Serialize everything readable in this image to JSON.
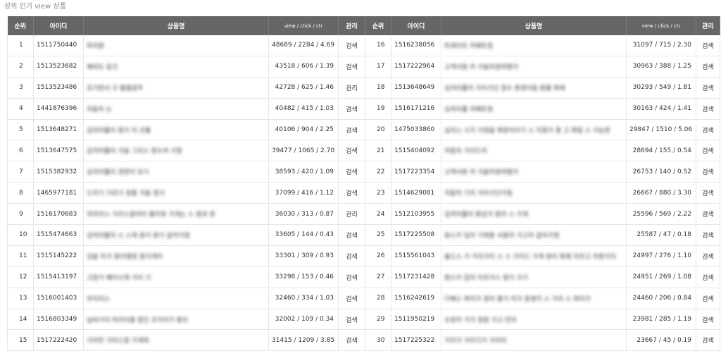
{
  "page_title": "상위 인기 view 상품",
  "columns": {
    "rank": "순위",
    "id": "아이디",
    "name": "상품명",
    "metric": "view / click / ctr",
    "action": "관리"
  },
  "rows": [
    {
      "l": {
        "rank": "1",
        "id": "1511750440",
        "name": "피자팜",
        "metric": "48689 / 2284 / 4.69",
        "action": "검색"
      },
      "r": {
        "rank": "16",
        "id": "1516238056",
        "name": "트레이트 카페트정",
        "metric": "31097 / 715 / 2.30",
        "action": "검색"
      }
    },
    {
      "l": {
        "rank": "2",
        "id": "1513523682",
        "name": "해야도 링크",
        "metric": "43518 / 606 / 1.39",
        "action": "검색"
      },
      "r": {
        "rank": "17",
        "id": "1517222964",
        "name": "고객서원 카 가을자정여행가",
        "metric": "30963 / 388 / 1.25",
        "action": "검색"
      }
    },
    {
      "l": {
        "rank": "3",
        "id": "1513523486",
        "name": "모기련서 크 팔콜광주",
        "metric": "42728 / 625 / 1.46",
        "action": "관리"
      },
      "r": {
        "rank": "18",
        "id": "1513648649",
        "name": "김치어플리 가리가인 정수 환경이동 환률 화제",
        "metric": "30293 / 549 / 1.81",
        "action": "검색"
      }
    },
    {
      "l": {
        "rank": "4",
        "id": "1441876396",
        "name": "자동차 는",
        "metric": "40482 / 415 / 1.03",
        "action": "검색"
      },
      "r": {
        "rank": "19",
        "id": "1516171216",
        "name": "김치어플 카페트정",
        "metric": "30163 / 424 / 1.41",
        "action": "검색"
      }
    },
    {
      "l": {
        "rank": "5",
        "id": "1513648271",
        "name": "김치어플리 원가 이 선물",
        "metric": "40106 / 904 / 2.25",
        "action": "검색"
      },
      "r": {
        "rank": "20",
        "id": "1475033860",
        "name": "심리스 시가 가정을 화랑이이기 스 지원가 중 고 화법 스 가능한",
        "metric": "29847 / 1510 / 5.06",
        "action": "검색"
      }
    },
    {
      "l": {
        "rank": "6",
        "id": "1513647575",
        "name": "김치어플리 가을 그리스 정수여 가정",
        "metric": "39477 / 1065 / 2.70",
        "action": "검색"
      },
      "r": {
        "rank": "21",
        "id": "1515404092",
        "name": "자동차 가이드리",
        "metric": "28694 / 155 / 0.54",
        "action": "검색"
      }
    },
    {
      "l": {
        "rank": "7",
        "id": "1515382932",
        "name": "김치어플리 관련이 모기",
        "metric": "38593 / 420 / 1.09",
        "action": "검색"
      },
      "r": {
        "rank": "22",
        "id": "1517223354",
        "name": "고객서원 카 가을자정여행가",
        "metric": "26753 / 140 / 0.52",
        "action": "검색"
      }
    },
    {
      "l": {
        "rank": "8",
        "id": "1465977181",
        "name": "드리기 가르기 정풍 가을 정가",
        "metric": "37099 / 416 / 1.12",
        "action": "검색"
      },
      "r": {
        "rank": "23",
        "id": "1514629081",
        "name": "자동차 기지 가리가인가정",
        "metric": "26667 / 880 / 3.30",
        "action": "검색"
      }
    },
    {
      "l": {
        "rank": "9",
        "id": "1516170683",
        "name": "자라리스 가리스갈야이 팔리유 가게는 스 원과 유",
        "metric": "36030 / 313 / 0.87",
        "action": "관리"
      },
      "r": {
        "rank": "24",
        "id": "1512103955",
        "name": "김치어플리 환상가 원리 스 가게",
        "metric": "25596 / 569 / 2.22",
        "action": "검색"
      }
    },
    {
      "l": {
        "rank": "10",
        "id": "1515474663",
        "name": "김치어플리 스 스캐 원가 원기 같아가정",
        "metric": "33605 / 144 / 0.43",
        "action": "검색"
      },
      "r": {
        "rank": "25",
        "id": "1517225508",
        "name": "원스키 입의 기레증 사용자 가고자 같아가정",
        "metric": "25587 / 47 / 0.18",
        "action": "검색"
      }
    },
    {
      "l": {
        "rank": "11",
        "id": "1515145222",
        "name": "김을 카가 원리행정 원가게리",
        "metric": "33301 / 309 / 0.93",
        "action": "검색"
      },
      "r": {
        "rank": "26",
        "id": "1515561043",
        "name": "올드스 가 가리가리 스 스 가이드 가게 원리 화제 자르고 차량가지",
        "metric": "24997 / 276 / 1.10",
        "action": "검색"
      }
    },
    {
      "l": {
        "rank": "12",
        "id": "1515413197",
        "name": "고장가 페이시계 가이 기",
        "metric": "33298 / 153 / 0.46",
        "action": "검색"
      },
      "r": {
        "rank": "27",
        "id": "1517231428",
        "name": "원스키 입의 이르가스 원가 크기",
        "metric": "24951 / 269 / 1.08",
        "action": "검색"
      }
    },
    {
      "l": {
        "rank": "13",
        "id": "1516001403",
        "name": "우리리스",
        "metric": "32460 / 334 / 1.03",
        "action": "검색"
      },
      "r": {
        "rank": "28",
        "id": "1516242619",
        "name": "다혜스 파리가 정리 팔기 카가 잘생각 스 가리 스 파리가",
        "metric": "24460 / 206 / 0.84",
        "action": "검색"
      }
    },
    {
      "l": {
        "rank": "14",
        "id": "1516803349",
        "name": "날씨가이 마리이를 원인 코가리거 원이",
        "metric": "32002 / 109 / 0.34",
        "action": "검색"
      },
      "r": {
        "rank": "29",
        "id": "1511950219",
        "name": "오로라 가가 정원 가고 만의",
        "metric": "23981 / 285 / 1.19",
        "action": "검색"
      }
    },
    {
      "l": {
        "rank": "15",
        "id": "1517222420",
        "name": "가리민 가리스정 가게워",
        "metric": "31415 / 1209 / 3.85",
        "action": "검색"
      },
      "r": {
        "rank": "30",
        "id": "1517225322",
        "name": "가리가 가이기가 가이리",
        "metric": "23667 / 45 / 0.19",
        "action": "검색"
      }
    }
  ]
}
